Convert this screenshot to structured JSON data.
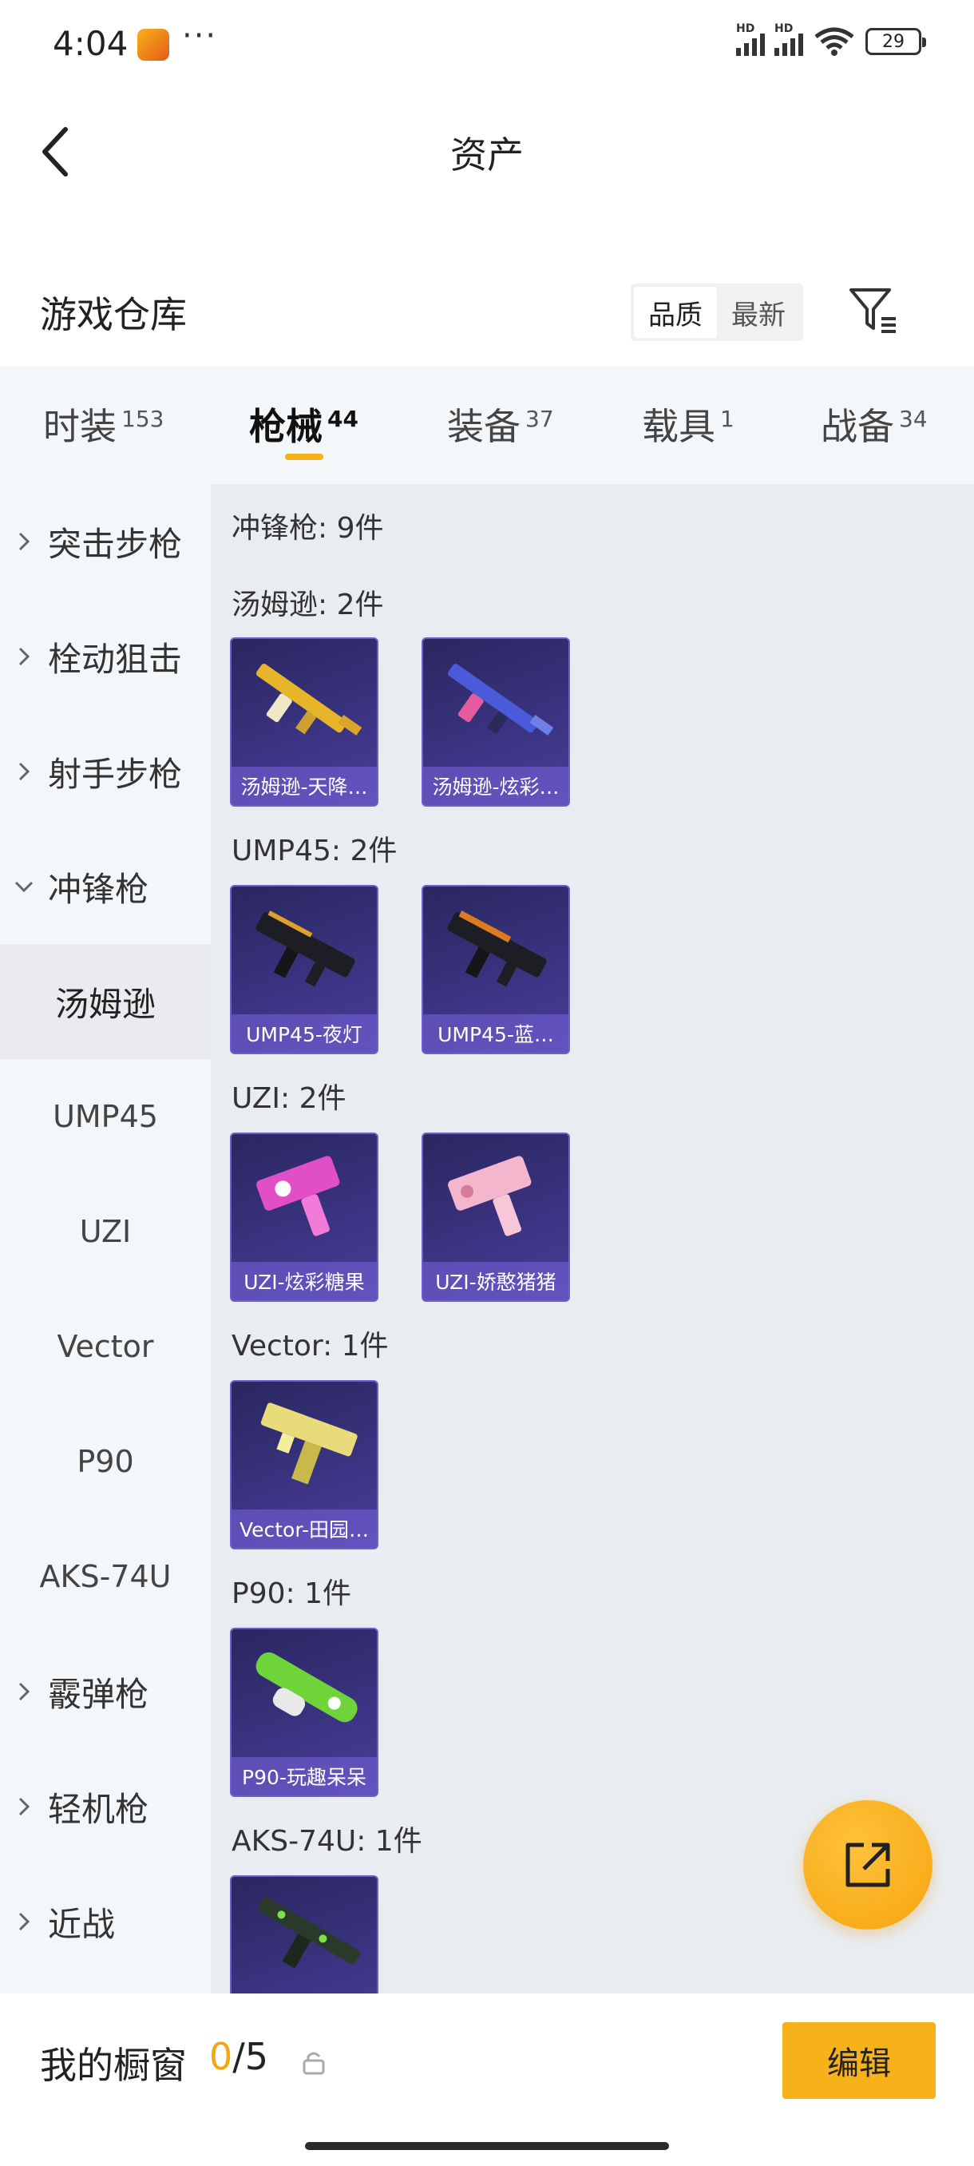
{
  "status_bar": {
    "time": "4:04",
    "dots": "···",
    "hd_label": "HD",
    "battery": "29"
  },
  "header": {
    "title": "资产"
  },
  "warehouse": {
    "title": "游戏仓库",
    "sort_options": [
      "品质",
      "最新"
    ],
    "active_sort": "品质"
  },
  "tabs": [
    {
      "label": "时装",
      "count": "153"
    },
    {
      "label": "枪械",
      "count": "44"
    },
    {
      "label": "装备",
      "count": "37"
    },
    {
      "label": "载具",
      "count": "1"
    },
    {
      "label": "战备",
      "count": "34"
    }
  ],
  "active_tab": "枪械",
  "sidebar": {
    "items": [
      {
        "label": "突击步枪"
      },
      {
        "label": "栓动狙击"
      },
      {
        "label": "射手步枪"
      },
      {
        "label": "冲锋枪"
      },
      {
        "label": "汤姆逊"
      },
      {
        "label": "UMP45"
      },
      {
        "label": "UZI"
      },
      {
        "label": "Vector"
      },
      {
        "label": "P90"
      },
      {
        "label": "AKS-74U"
      },
      {
        "label": "霰弹枪"
      },
      {
        "label": "轻机枪"
      },
      {
        "label": "近战"
      }
    ],
    "selected": "汤姆逊"
  },
  "content": {
    "category_header": "冲锋枪: 9件",
    "groups": [
      {
        "title": "汤姆逊: 2件",
        "items": [
          "汤姆逊-天降…",
          "汤姆逊-炫彩…"
        ]
      },
      {
        "title": "UMP45: 2件",
        "items": [
          "UMP45-夜灯",
          "UMP45-蓝…"
        ]
      },
      {
        "title": "UZI: 2件",
        "items": [
          "UZI-炫彩糖果",
          "UZI-娇憨猪猪"
        ]
      },
      {
        "title": "Vector: 1件",
        "items": [
          "Vector-田园…"
        ]
      },
      {
        "title": "P90: 1件",
        "items": [
          "P90-玩趣呆呆"
        ]
      },
      {
        "title": "AKS-74U: 1件",
        "items": []
      }
    ]
  },
  "bottom": {
    "showcase_label": "我的橱窗",
    "showcase_used": "0",
    "showcase_sep": "/",
    "showcase_total": "5",
    "edit_label": "编辑"
  },
  "colors": {
    "accent": "#f7b21a",
    "card_bg": "#3a3380",
    "sidebar_bg": "#f4f7fa",
    "content_bg": "#e9edf1"
  }
}
